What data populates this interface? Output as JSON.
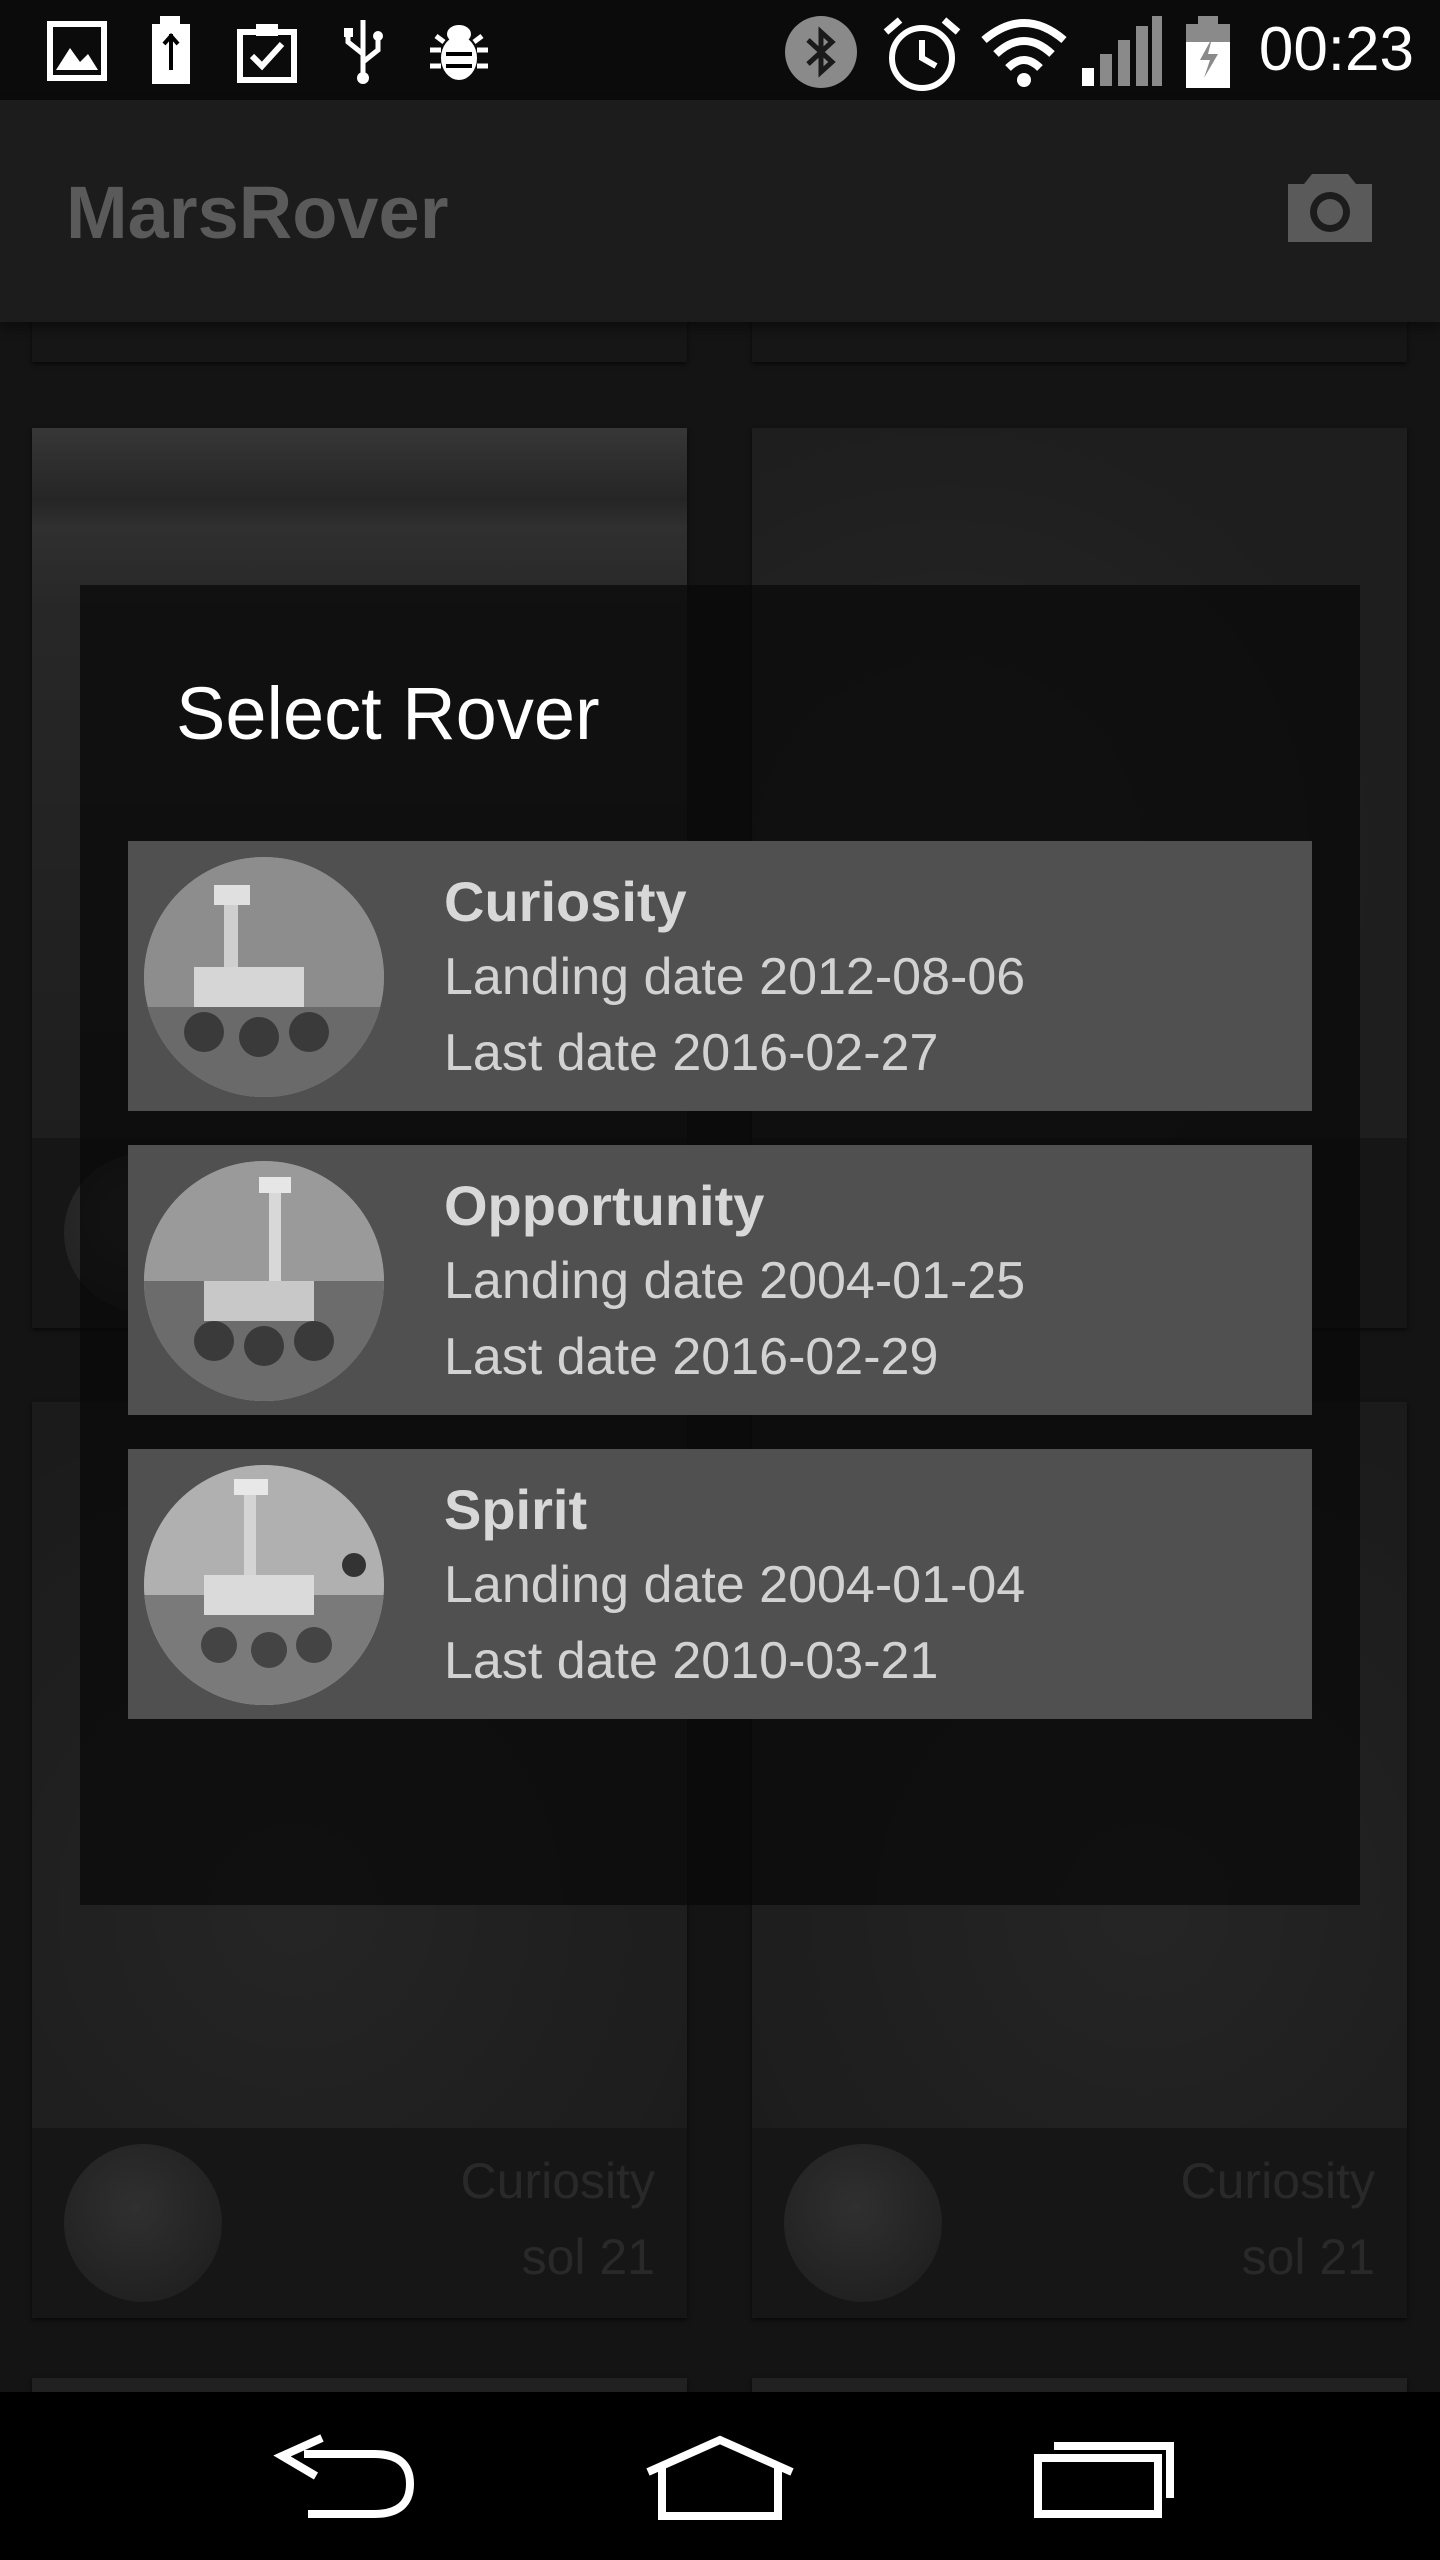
{
  "status_bar": {
    "time": "00:23",
    "icons": [
      "image-icon",
      "usb-battery-icon",
      "clipboard-check-icon",
      "usb-icon",
      "bug-icon",
      "bluetooth-icon",
      "alarm-icon",
      "wifi-icon",
      "signal-icon",
      "battery-charging-icon"
    ]
  },
  "app_bar": {
    "title": "MarsRover",
    "action_icon": "camera-icon"
  },
  "background_cards": [
    {
      "rover": "",
      "sol": ""
    },
    {
      "rover": "",
      "sol": ""
    },
    {
      "rover": "Curiosity",
      "sol": "sol 21"
    },
    {
      "rover": "Curiosity",
      "sol": "sol 21"
    }
  ],
  "dialog": {
    "title": "Select Rover",
    "rovers": [
      {
        "name": "Curiosity",
        "landing": "Landing date 2012-08-06",
        "last": "Last date 2016-02-27"
      },
      {
        "name": "Opportunity",
        "landing": "Landing date 2004-01-25",
        "last": "Last date 2016-02-29"
      },
      {
        "name": "Spirit",
        "landing": "Landing date 2004-01-04",
        "last": "Last date 2010-03-21"
      }
    ]
  },
  "nav_bar": {
    "buttons": [
      "back-icon",
      "home-icon",
      "recents-icon"
    ]
  }
}
